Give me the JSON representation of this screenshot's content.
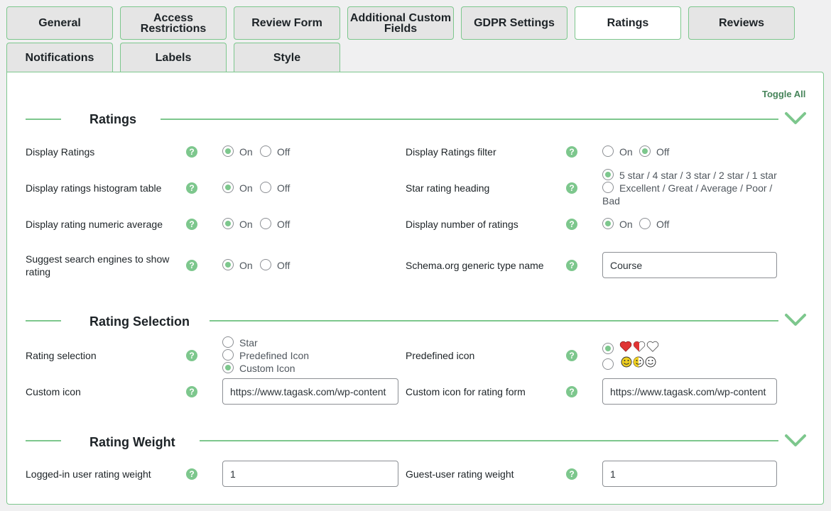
{
  "tabs": [
    {
      "label": "General"
    },
    {
      "label": "Access Restrictions"
    },
    {
      "label": "Review Form"
    },
    {
      "label": "Additional Custom Fields"
    },
    {
      "label": "GDPR Settings"
    },
    {
      "label": "Ratings"
    },
    {
      "label": "Reviews"
    },
    {
      "label": "Notifications"
    },
    {
      "label": "Labels"
    },
    {
      "label": "Style"
    }
  ],
  "active_tab": "Ratings",
  "toggle_all": "Toggle All",
  "help_glyph": "?",
  "colors": {
    "accent": "#7dc78d",
    "toggle_text": "#46845a",
    "heart": "#e03434",
    "smiley": "#f0d020"
  },
  "sections": {
    "ratings": {
      "title": "Ratings",
      "display_ratings": {
        "label": "Display Ratings",
        "on": "On",
        "off": "Off",
        "selected": "On"
      },
      "display_ratings_filter": {
        "label": "Display Ratings filter",
        "on": "On",
        "off": "Off",
        "selected": "Off"
      },
      "histogram": {
        "label": "Display ratings histogram table",
        "on": "On",
        "off": "Off",
        "selected": "On"
      },
      "star_heading": {
        "label": "Star rating heading",
        "option1": "5 star / 4 star / 3 star / 2 star / 1 star",
        "option2_line1": "Excellent / Great / Average / Poor /",
        "option2_line2": "Bad",
        "selected": 1
      },
      "numeric_average": {
        "label": "Display rating numeric average",
        "on": "On",
        "off": "Off",
        "selected": "On"
      },
      "number_of_ratings": {
        "label": "Display number of ratings",
        "on": "On",
        "off": "Off",
        "selected": "On"
      },
      "suggest_search": {
        "label_line1": "Suggest search engines to show",
        "label_line2": "rating",
        "on": "On",
        "off": "Off",
        "selected": "On"
      },
      "schema_type": {
        "label": "Schema.org generic type name",
        "value": "Course"
      }
    },
    "rating_selection": {
      "title": "Rating Selection",
      "rating_selection": {
        "label": "Rating selection",
        "options": [
          "Star",
          "Predefined Icon",
          "Custom Icon"
        ],
        "selected": "Custom Icon"
      },
      "predefined_icon": {
        "label": "Predefined icon",
        "selected": 1,
        "option_icons": [
          "heart-set-icon",
          "smiley-set-icon"
        ]
      },
      "custom_icon": {
        "label": "Custom icon",
        "value": "https://www.tagask.com/wp-content"
      },
      "custom_icon_form": {
        "label": "Custom icon for rating form",
        "value": "https://www.tagask.com/wp-content"
      }
    },
    "rating_weight": {
      "title": "Rating Weight",
      "logged_in": {
        "label": "Logged-in user rating weight",
        "value": "1"
      },
      "guest": {
        "label": "Guest-user rating weight",
        "value": "1"
      }
    }
  }
}
